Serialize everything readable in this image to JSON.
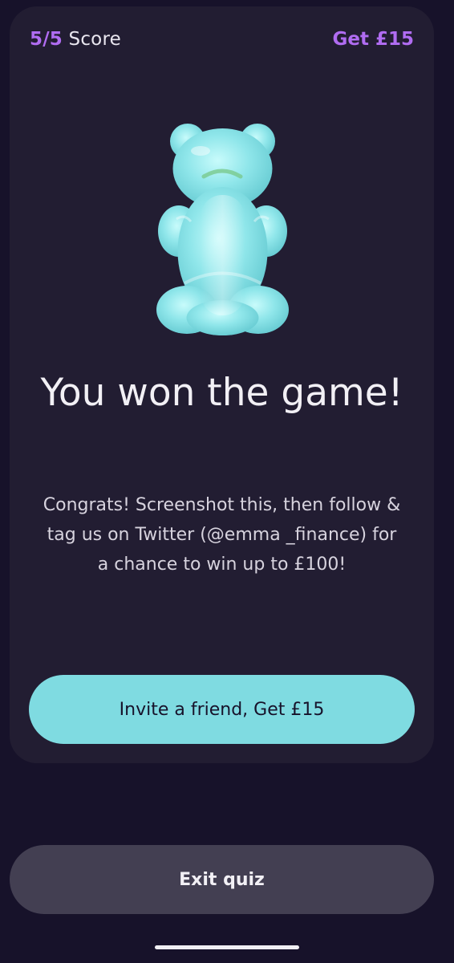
{
  "header": {
    "score_value": "5/5",
    "score_label": "Score",
    "reward_link": "Get £15"
  },
  "result": {
    "icon": "gummy-bear-icon",
    "title": "You won the game!",
    "message": "Congrats! Screenshot this, then follow & tag us on Twitter (@emma _finance) for a chance to win up to £100!"
  },
  "actions": {
    "invite_label": "Invite a friend, Get £15",
    "exit_label": "Exit quiz"
  },
  "colors": {
    "background": "#17122a",
    "card": "#221d32",
    "accent_purple": "#b06cf1",
    "accent_teal": "#7fdbe1",
    "secondary_button": "#433f52"
  }
}
